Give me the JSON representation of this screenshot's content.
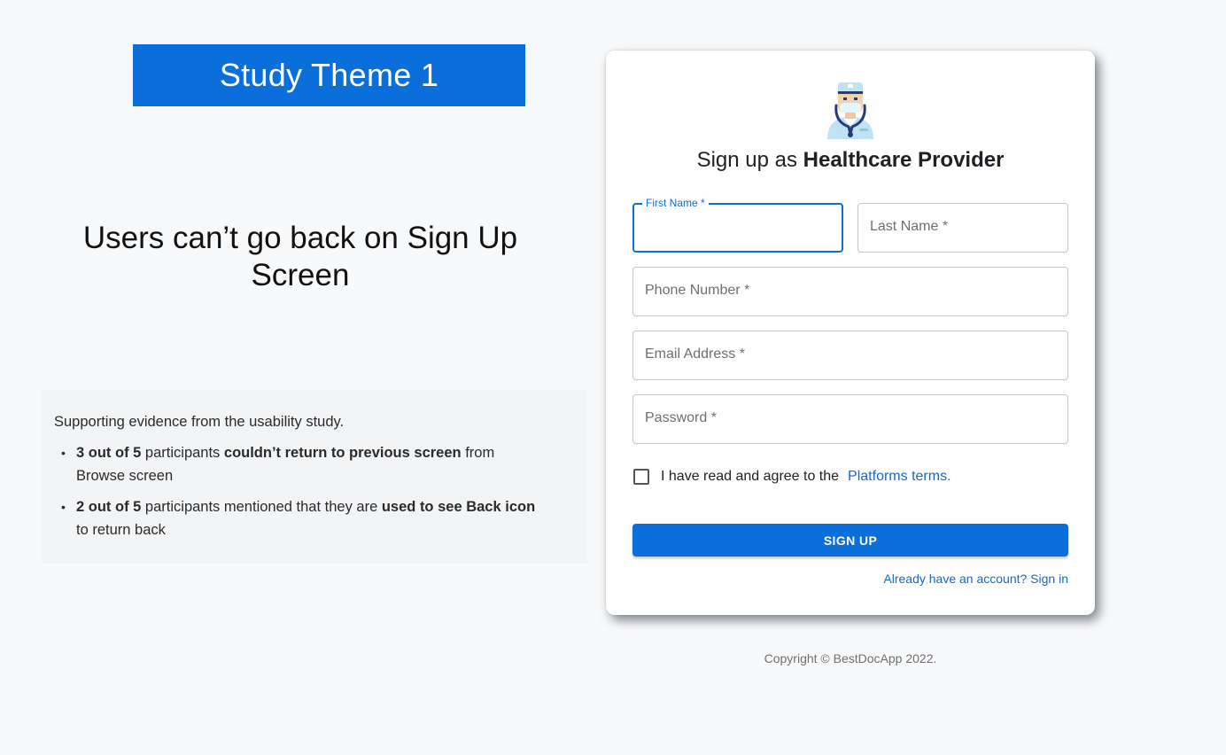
{
  "left": {
    "theme_banner": "Study Theme 1",
    "problem_title": "Users can’t go back on Sign Up Screen",
    "evidence": {
      "intro": "Supporting evidence from the usability study.",
      "items": [
        {
          "a": "3 out of 5",
          "b": " participants ",
          "c": "couldn’t return to previous screen",
          "d": " from Browse screen"
        },
        {
          "a": "2 out of 5",
          "b": " participants mentioned that they are ",
          "c": "used to see Back icon",
          "d": " to return back"
        }
      ]
    }
  },
  "signup": {
    "heading_prefix": "Sign up as ",
    "heading_bold": "Healthcare Provider",
    "fields": {
      "first_name": "First Name *",
      "last_name": "Last Name *",
      "phone": "Phone Number *",
      "email": "Email Address *",
      "password": "Password *"
    },
    "terms_text": "I have read and agree to the",
    "terms_link": "Platforms terms.",
    "button": "SIGN UP",
    "signin_link": "Already have an account? Sign in"
  },
  "footer": {
    "copyright": "Copyright © BestDocApp 2022."
  },
  "colors": {
    "primary": "#0a6edb",
    "link": "#1a66c7",
    "background": "#f8f9fb"
  },
  "icons": {
    "avatar": "doctor-icon"
  }
}
